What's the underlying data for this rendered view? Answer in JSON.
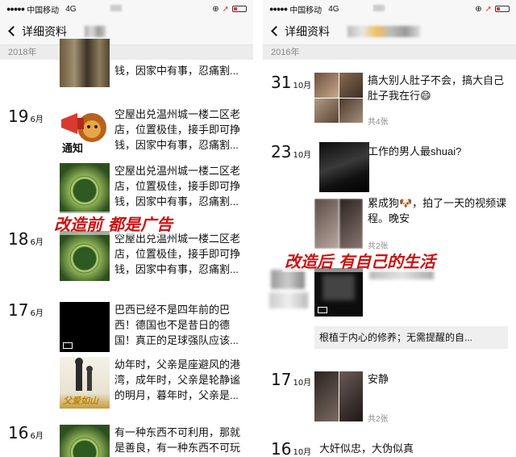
{
  "left": {
    "status": {
      "carrier": "中国移动",
      "network": "4G"
    },
    "nav": {
      "back_label": "详细资料"
    },
    "year": "2018年",
    "top_text": "钱，因家中有事，忍痛割...",
    "entries": [
      {
        "day": "19",
        "month": "6月",
        "posts": [
          {
            "text": "空屋出兑温州城一楼二区老店，位置极佳，接手即可挣钱，因家中有事，忍痛割..."
          },
          {
            "text": "空屋出兑温州城一楼二区老店，位置极佳，接手即可挣钱，因家中有事，忍痛割..."
          }
        ]
      },
      {
        "day": "18",
        "month": "6月",
        "posts": [
          {
            "text": "空屋出兑温州城一楼二区老店，位置极佳，接手即可挣钱，因家中有事，忍痛割..."
          }
        ]
      },
      {
        "day": "17",
        "month": "6月",
        "posts": [
          {
            "text": "巴西已经不是四年前的巴西！德国也不是昔日的德国！真正的足球强队应该..."
          },
          {
            "text": "幼年时，父亲是座避风的港湾，成年时，父亲是轮静谧的明月，暮年时，父亲是..."
          }
        ]
      },
      {
        "day": "16",
        "month": "6月",
        "posts": [
          {
            "text": "有一种东西不可利用，那就是善良，有一种东西不可玩"
          }
        ]
      }
    ],
    "thumb_texts": {
      "notice": "通知",
      "poster": "父爱如山"
    },
    "overlay": "改造前  都是广告"
  },
  "right": {
    "status": {
      "carrier": "中国移动",
      "network": "4G"
    },
    "nav": {
      "back_label": "详细资料"
    },
    "year": "2016年",
    "entries": [
      {
        "day": "31",
        "month": "10月",
        "text": "搞大别人肚子不会，搞大自己肚子我在行😄",
        "count": "共4张"
      },
      {
        "day": "23",
        "month": "10月",
        "text": "工作的男人最shuai?"
      },
      {
        "text": "累成狗🐶，拍了一天的视频课程。晚安",
        "count": "共2张"
      },
      {
        "repost": "根植于内心的修养；无需提醒的自..."
      },
      {
        "day": "17",
        "month": "10月",
        "text": "安静",
        "count": "共2张"
      },
      {
        "day": "16",
        "month": "10月",
        "text": "大奸似忠，大伪似真"
      }
    ],
    "overlay": "改造后  有自己的生活"
  },
  "colors": {
    "overlay_red": "#d01010",
    "year_bar": "#ececec",
    "nav_bg": "#f7f7f7"
  }
}
